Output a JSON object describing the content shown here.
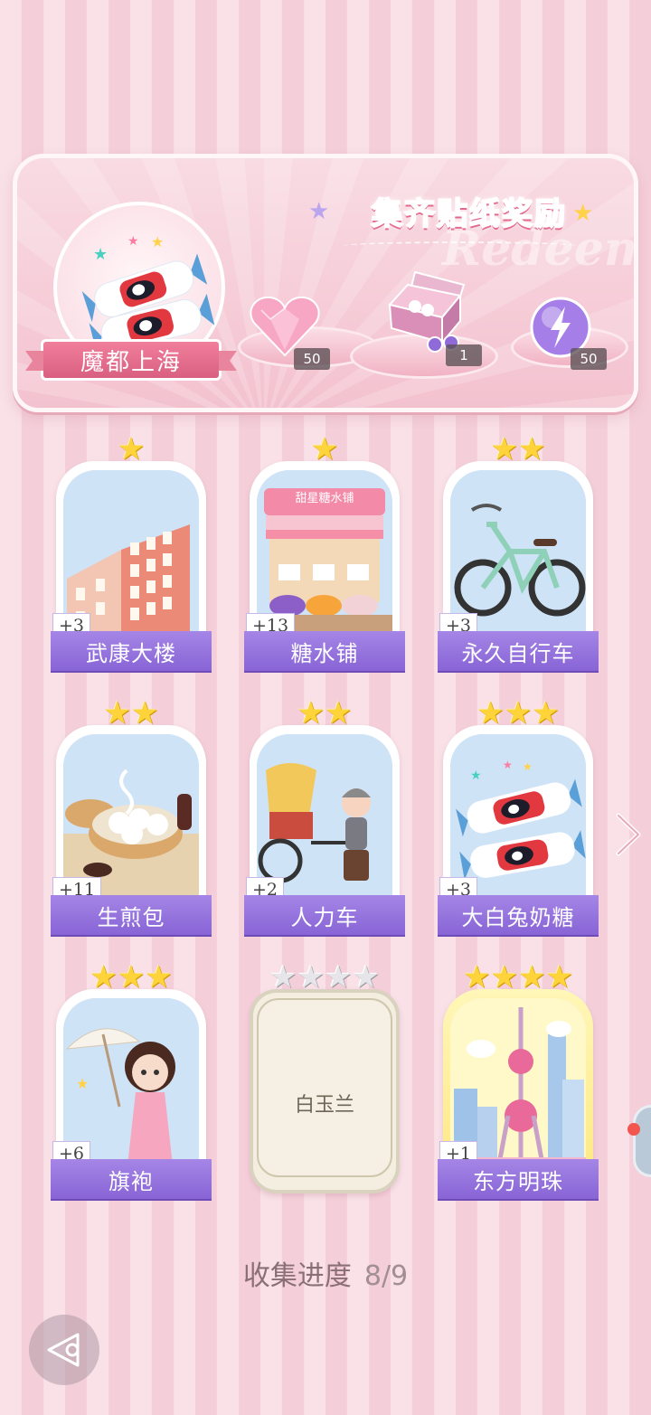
{
  "banner": {
    "title": "集齐贴纸奖励",
    "watermark": "Redeem",
    "city_name": "魔都上海",
    "rewards": [
      {
        "icon": "pink-heart-gem-icon",
        "count": "50"
      },
      {
        "icon": "sticker-gift-box-icon",
        "count": "1"
      },
      {
        "icon": "lightning-orb-icon",
        "count": "50"
      }
    ]
  },
  "cards": [
    {
      "name": "武康大楼",
      "plus": "+3",
      "stars": 1,
      "state": "collected",
      "art": "building-icon"
    },
    {
      "name": "糖水铺",
      "plus": "+13",
      "stars": 1,
      "state": "collected",
      "art": "dessert-shop-icon",
      "shop_sign": "甜星糖水铺"
    },
    {
      "name": "永久自行车",
      "plus": "+3",
      "stars": 2,
      "state": "collected",
      "art": "bicycle-icon"
    },
    {
      "name": "生煎包",
      "plus": "+11",
      "stars": 2,
      "state": "collected",
      "art": "buns-icon"
    },
    {
      "name": "人力车",
      "plus": "+2",
      "stars": 2,
      "state": "collected",
      "art": "rickshaw-icon"
    },
    {
      "name": "大白兔奶糖",
      "plus": "+3",
      "stars": 3,
      "state": "collected",
      "art": "rabbit-candy-icon"
    },
    {
      "name": "旗袍",
      "plus": "+6",
      "stars": 3,
      "state": "collected",
      "art": "qipao-girl-icon"
    },
    {
      "name": "白玉兰",
      "plus": "",
      "stars": 4,
      "state": "locked",
      "art": ""
    },
    {
      "name": "东方明珠",
      "plus": "+1",
      "stars": 4,
      "state": "golden",
      "art": "pearl-tower-icon"
    }
  ],
  "progress": {
    "label": "收集进度",
    "value": "8/9"
  },
  "colors": {
    "label_purple": "#8864d6",
    "banner_pink": "#f3c2cf",
    "star_gold": "#ffd43a"
  }
}
